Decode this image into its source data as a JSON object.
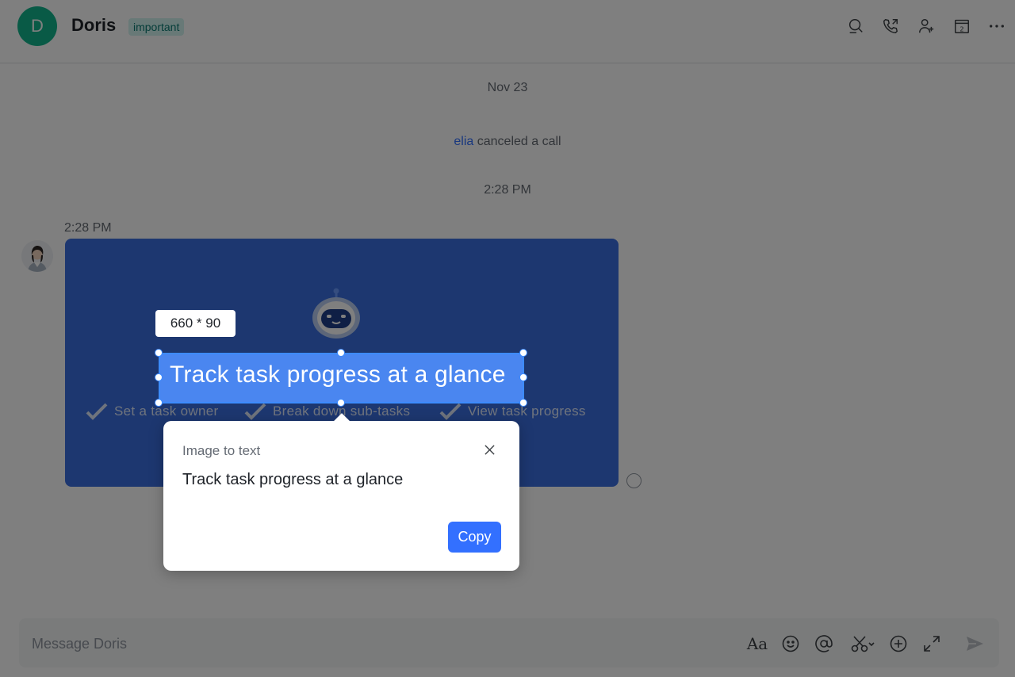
{
  "header": {
    "avatar_letter": "D",
    "title": "Doris",
    "tag": "important",
    "icons": [
      "search-icon",
      "call-icon",
      "add-member-icon",
      "calendar-icon",
      "more-icon"
    ],
    "calendar_day": "2"
  },
  "messages": {
    "date_divider": "Nov 23",
    "system_user": "elia",
    "system_action": "canceled a call",
    "time_divider": "2:28 PM",
    "message_time": "2:28 PM"
  },
  "card": {
    "headline": "Track task progress at a glance",
    "features": [
      "Set a task owner",
      "Break down sub-tasks",
      "View task progress"
    ],
    "background_color": "#3a6ee0"
  },
  "screenshot_tool": {
    "size_label": "660 * 90",
    "selection_text": "Track task progress at a glance"
  },
  "popup": {
    "title": "Image to text",
    "body": "Track task progress at a glance",
    "copy_label": "Copy"
  },
  "input": {
    "placeholder": "Message Doris",
    "format_icon_text": "Aa"
  },
  "colors": {
    "accent": "#3370ff",
    "avatar": "#12b58c",
    "tag_bg": "#d1f2ee"
  }
}
